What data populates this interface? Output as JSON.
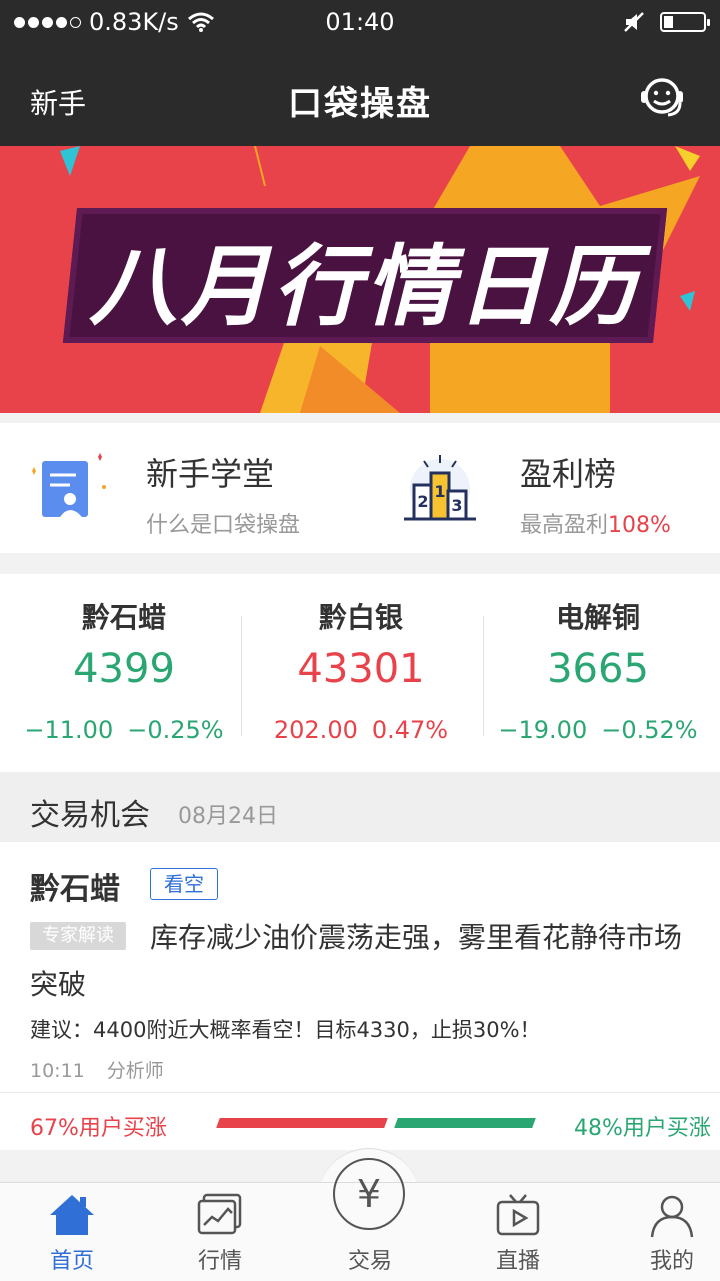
{
  "status": {
    "signal": "●●●●○",
    "speed": "0.83K/s",
    "time": "01:40"
  },
  "nav": {
    "left_label": "新手",
    "title": "口袋操盘"
  },
  "banner": {
    "text": "八月行情日历"
  },
  "quick": [
    {
      "title": "新手学堂",
      "subtitle": "什么是口袋操盘",
      "subtitle_highlight": ""
    },
    {
      "title": "盈利榜",
      "subtitle": "最高盈利",
      "subtitle_highlight": "108%"
    }
  ],
  "market": [
    {
      "name": "黔石蜡",
      "price": "4399",
      "change": "−11.00",
      "percent": "−0.25%",
      "trend": "down"
    },
    {
      "name": "黔白银",
      "price": "43301",
      "change": "202.00",
      "percent": "0.47%",
      "trend": "up"
    },
    {
      "name": "电解铜",
      "price": "3665",
      "change": "−19.00",
      "percent": "−0.52%",
      "trend": "down"
    }
  ],
  "opportunity": {
    "title": "交易机会",
    "date": "08月24日",
    "card": {
      "name": "黔石蜡",
      "badge": "看空",
      "tag": "专家解读",
      "headline": "库存减少油价震荡走强，雾里看花静待市场突破",
      "advice": "建议：4400附近大概率看空！目标4330，止损30%！",
      "time": "10:11",
      "author": "分析师",
      "vote_up": "67%用户买涨",
      "vote_other": "48%用户买涨"
    }
  },
  "tabs": [
    {
      "label": "首页",
      "icon": "home-icon"
    },
    {
      "label": "行情",
      "icon": "chart-icon"
    },
    {
      "label": "交易",
      "icon": "yuan-icon",
      "symbol": "¥"
    },
    {
      "label": "直播",
      "icon": "tv-icon"
    },
    {
      "label": "我的",
      "icon": "user-icon"
    }
  ],
  "colors": {
    "up": "#e8424a",
    "down": "#2aa673",
    "accent": "#2f6fd6",
    "header": "#2b2b2b"
  }
}
